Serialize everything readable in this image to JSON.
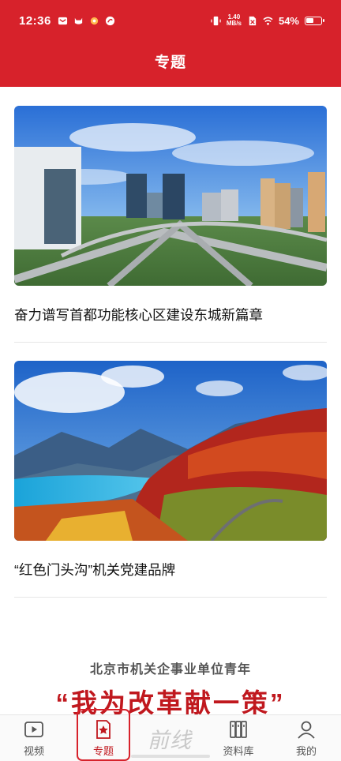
{
  "status": {
    "time": "12:36",
    "speed_value": "1.40",
    "speed_unit": "MB/s",
    "battery": "54%",
    "battery_level": 0.54
  },
  "header": {
    "title": "专题"
  },
  "cards": [
    {
      "title": "奋力谱写首都功能核心区建设东城新篇章",
      "image": "city-skyline"
    },
    {
      "title": "“红色门头沟”机关党建品牌",
      "image": "mountain-landscape"
    }
  ],
  "banner": {
    "subtitle": "北京市机关企事业单位青年",
    "headline": "“我为改革献一策”"
  },
  "nav": {
    "items": [
      {
        "label": "视频",
        "icon": "play-box-icon"
      },
      {
        "label": "专题",
        "icon": "star-document-icon",
        "active": true
      },
      {
        "label": "",
        "logo_text": "前线",
        "icon": "logo"
      },
      {
        "label": "资料库",
        "icon": "bookshelf-icon"
      },
      {
        "label": "我的",
        "icon": "user-icon"
      }
    ]
  },
  "colors": {
    "brand_red": "#d7222b",
    "active_red": "#c0181e"
  }
}
